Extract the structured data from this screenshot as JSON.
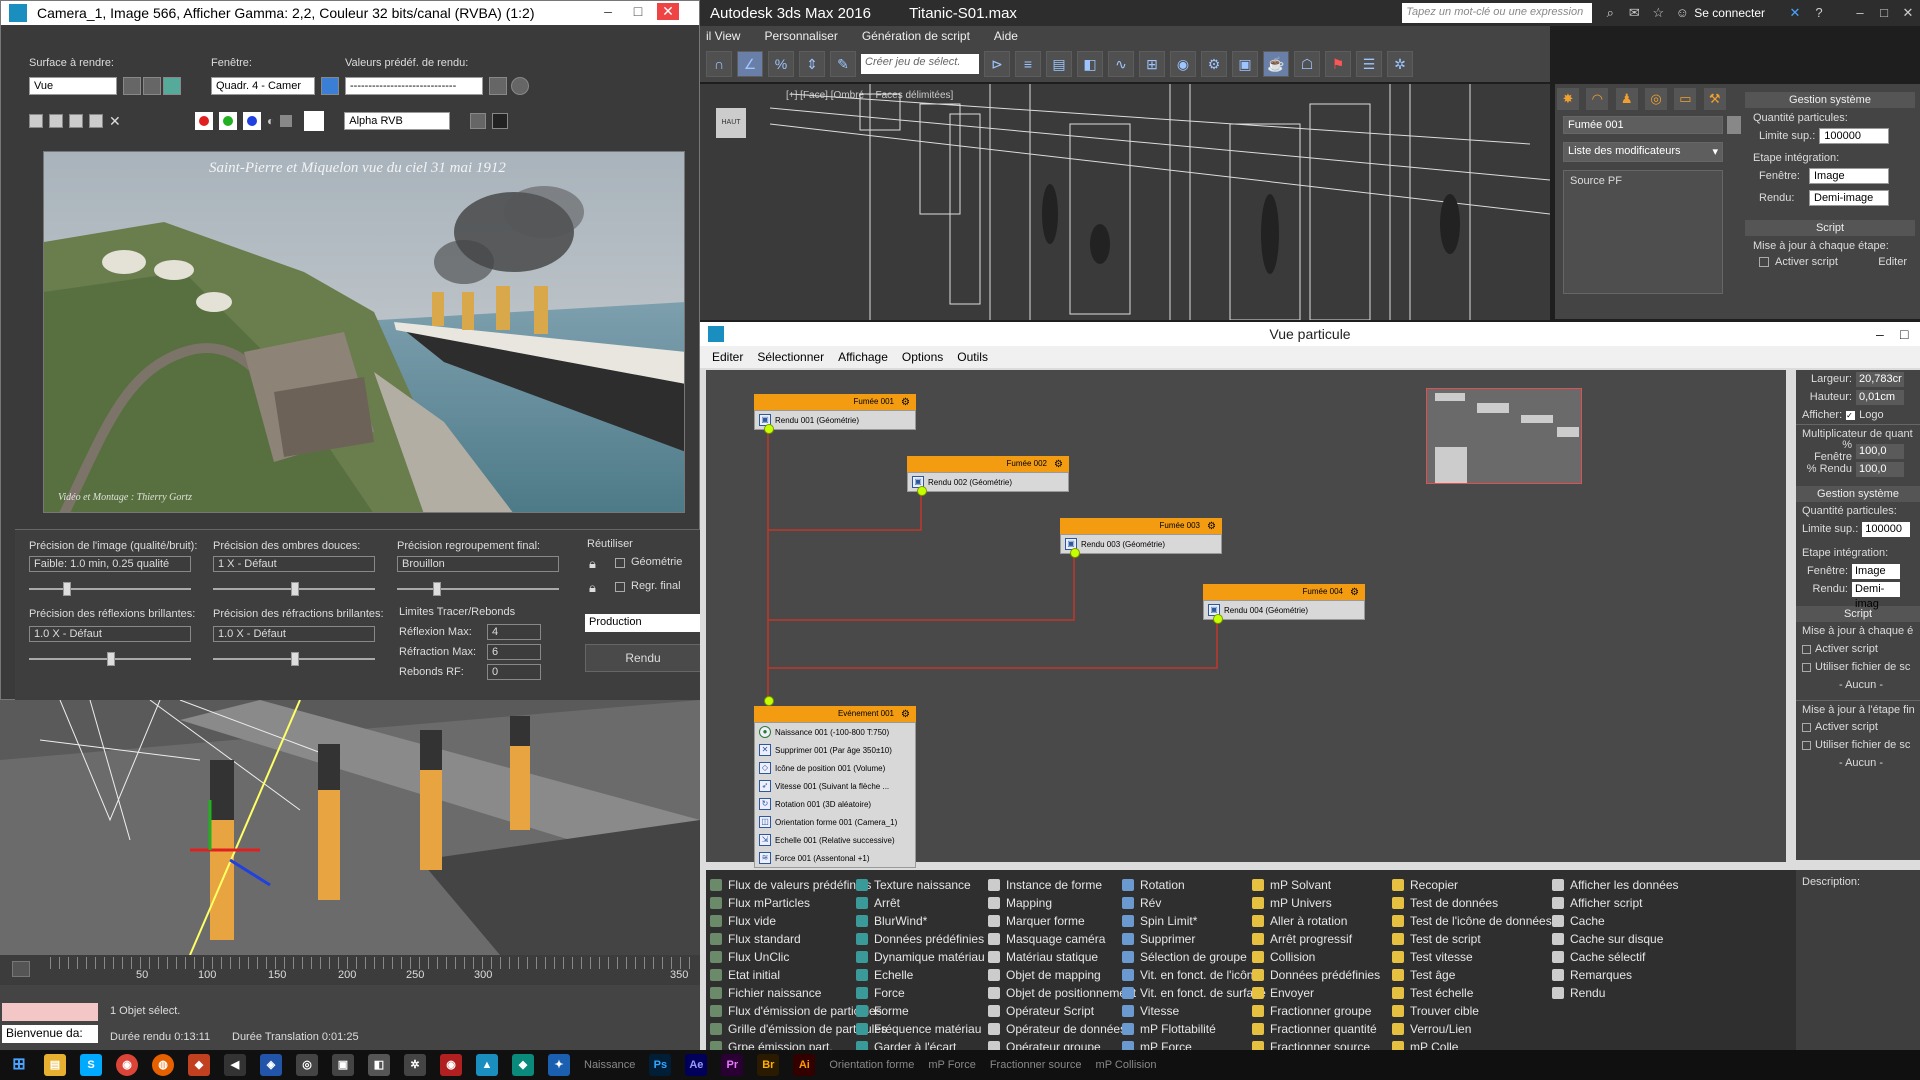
{
  "app": {
    "title": "Autodesk 3ds Max 2016",
    "file": "Titanic-S01.max",
    "search_placeholder": "Tapez un mot-clé ou une expression",
    "connect": "Se connecter",
    "menus": [
      "il View",
      "Personnaliser",
      "Génération de script",
      "Aide"
    ],
    "selection_set_placeholder": "Créer jeu de sélect.",
    "viewport_top_label": "[+] [Face] [Ombré + Faces délimitées]",
    "viewcube_label": "HAUT"
  },
  "command_panel": {
    "object_name": "Fumée 001",
    "modifier_list": "Liste des modificateurs",
    "stack_item": "Source PF",
    "rollout_system": "Gestion système",
    "particle_qty": "Quantité particules:",
    "upper_limit": "Limite sup.:",
    "upper_limit_value": "100000",
    "integration_step": "Etape intégration:",
    "viewport": "Fenêtre:",
    "viewport_value": "Image",
    "render": "Rendu:",
    "render_value": "Demi-image",
    "rollout_script": "Script",
    "update_each_step": "Mise à jour à chaque étape:",
    "activate_script": "Activer script",
    "edit": "Editer"
  },
  "render_window": {
    "title": "Camera_1, Image 566, Afficher Gamma: 2,2, Couleur 32 bits/canal (RVBA) (1:2)",
    "area_label": "Surface à rendre:",
    "area_value": "Vue",
    "viewport_label": "Fenêtre:",
    "viewport_value": "Quadr. 4 - Camer",
    "preset_label": "Valeurs prédéf. de rendu:",
    "preset_value": "-----------------------------",
    "channel_value": "Alpha RVB",
    "image_caption": "Saint-Pierre et Miquelon vue du ciel 31 mai 1912",
    "image_credit": "Vidéo et Montage : Thierry Gortz",
    "settings": {
      "image_precision_label": "Précision de l'image (qualité/bruit):",
      "image_precision_value": "Faible: 1.0 min, 0.25 qualité",
      "soft_shadows_label": "Précision des ombres douces:",
      "soft_shadows_value": "1 X - Défaut",
      "final_gather_label": "Précision regroupement final:",
      "final_gather_value": "Brouillon",
      "reuse_label": "Réutiliser",
      "geometry": "Géométrie",
      "final_gather_check": "Regr. final",
      "reflections_label": "Précision des réflexions brillantes:",
      "reflections_value": "1.0 X - Défaut",
      "refractions_label": "Précision des réfractions brillantes:",
      "refractions_value": "1.0 X - Défaut",
      "trace_limits": "Limites Tracer/Rebonds",
      "reflection_max": "Réflexion Max:",
      "reflection_max_value": "4",
      "refraction_max": "Réfraction Max:",
      "refraction_max_value": "6",
      "bounces": "Rebonds RF:",
      "bounces_value": "0",
      "production": "Production",
      "render_button": "Rendu"
    }
  },
  "timeline": {
    "ticks": [
      "50",
      "100",
      "150",
      "200",
      "250",
      "300",
      "350"
    ]
  },
  "status": {
    "welcome": "Bienvenue da:",
    "selection": "1 Objet sélect.",
    "render_time": "Durée rendu  0:13:11",
    "translation_time": "Durée Translation  0:01:25"
  },
  "particle_view": {
    "title": "Vue particule",
    "menus": [
      "Editer",
      "Sélectionner",
      "Affichage",
      "Options",
      "Outils"
    ],
    "nodes": [
      {
        "head": "Fumée 001",
        "row": "Rendu 001 (Géométrie)"
      },
      {
        "head": "Fumée 002",
        "row": "Rendu 002 (Géométrie)"
      },
      {
        "head": "Fumée 003",
        "row": "Rendu 003 (Géométrie)"
      },
      {
        "head": "Fumée 004",
        "row": "Rendu 004 (Géométrie)"
      }
    ],
    "event": {
      "head": "Evénement 001",
      "rows": [
        "Naissance 001 (-100-800 T:750)",
        "Supprimer 001 (Par âge 350±10)",
        "Icône de position 001 (Volume)",
        "Vitesse 001 (Suivant la flèche ...",
        "Rotation 001 (3D aléatoire)",
        "Orientation forme 001 (Camera_1)",
        "Echelle 001 (Relative successive)",
        "Force 001 (Assentonal +1)"
      ]
    },
    "params": {
      "width": "Largeur:",
      "width_value": "20,783cr",
      "height": "Hauteur:",
      "height_value": "0,01cm",
      "display": "Afficher:",
      "logo": "Logo",
      "qty_multiplier": "Multiplicateur de quant",
      "pct_viewport": "% Fenêtre",
      "pct_viewport_value": "100,0",
      "pct_render": "% Rendu",
      "pct_render_value": "100,0",
      "system": "Gestion système",
      "particle_qty": "Quantité particules:",
      "upper_limit": "Limite sup.:",
      "upper_limit_value": "100000",
      "integration_step": "Etape intégration:",
      "viewport": "Fenêtre:",
      "viewport_value": "Image",
      "render": "Rendu:",
      "render_value": "Demi-imag",
      "script": "Script",
      "update_each": "Mise à jour à chaque é",
      "activate_script": "Activer script",
      "use_script_file": "Utiliser fichier de sc",
      "none": "- Aucun -",
      "update_final": "Mise à jour à l'étape fin",
      "description": "Description:"
    },
    "depot": [
      [
        "Flux de valeurs prédéfinies",
        "Flux mParticles",
        "Flux vide",
        "Flux standard",
        "Flux UnClic",
        "Etat initial",
        "Fichier naissance",
        "Flux d'émission de particules",
        "Grille d'émission de particules",
        "Grpe émission part."
      ],
      [
        "Texture naissance",
        "Arrêt",
        "BlurWind*",
        "Données prédéfinies",
        "Dynamique matériau",
        "Echelle",
        "Force",
        "Forme",
        "Fréquence matériau",
        "Garder à l'écart"
      ],
      [
        "Instance de forme",
        "Mapping",
        "Marquer forme",
        "Masquage caméra",
        "Matériau statique",
        "Objet de mapping",
        "Objet de positionnement",
        "Opérateur Script",
        "Opérateur de données",
        "Opérateur groupe"
      ],
      [
        "Rotation",
        "Rév",
        "Spin Limit*",
        "Supprimer",
        "Sélection de groupe",
        "Vit. en fonct. de l'icône",
        "Vit. en fonct. de surface",
        "Vitesse",
        "mP Flottabilité",
        "mP Force"
      ],
      [
        "mP Solvant",
        "mP Univers",
        "Aller à rotation",
        "Arrêt progressif",
        "Collision",
        "Données prédéfinies",
        "Envoyer",
        "Fractionner groupe",
        "Fractionner quantité",
        "Fractionner source"
      ],
      [
        "Recopier",
        "Test de données",
        "Test de l'icône de données",
        "Test de script",
        "Test vitesse",
        "Test âge",
        "Test échelle",
        "Trouver cible",
        "Verrou/Lien",
        "mP Colle"
      ],
      [
        "Afficher les données",
        "Afficher script",
        "Cache",
        "Cache sur disque",
        "Cache sélectif",
        "Remarques",
        "Rendu"
      ]
    ]
  },
  "taskbar": {
    "items": [
      "Naissance",
      "Orientation forme",
      "mP Force",
      "Fractionner source",
      "mP Collision"
    ]
  },
  "colors": {
    "node_header": "#f39c12",
    "wire": "#c0392b",
    "port": "#c6ff00",
    "graph_bg": "#494949"
  }
}
